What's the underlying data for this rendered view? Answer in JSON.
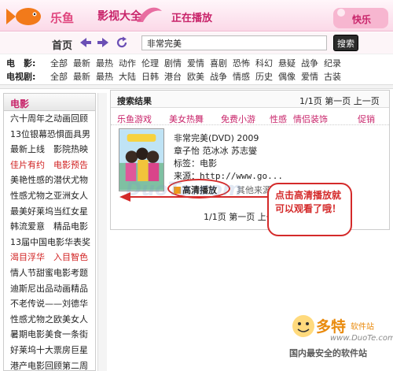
{
  "header": {
    "logo_text": "乐鱼",
    "app_title": "影视大全",
    "now_playing": "正在播放",
    "badge_text": "快乐"
  },
  "nav": {
    "home": "首页",
    "search_value": "非常完美",
    "search_button": "搜索"
  },
  "categories": [
    {
      "label": "电　影:",
      "items": [
        "全部",
        "最新",
        "最热",
        "动作",
        "伦理",
        "剧情",
        "爱情",
        "喜剧",
        "恐怖",
        "科幻",
        "悬疑",
        "战争",
        "纪录"
      ]
    },
    {
      "label": "电视剧:",
      "items": [
        "全部",
        "最新",
        "最热",
        "大陆",
        "日韩",
        "港台",
        "欧美",
        "战争",
        "情感",
        "历史",
        "偶像",
        "爱情",
        "古装"
      ]
    }
  ],
  "sidebar": {
    "title": "电影",
    "items": [
      {
        "text": "六十周年之动画回顾",
        "red": false
      },
      {
        "text": "13位银幕恐惧面具男",
        "red": false
      },
      {
        "text": "最新上线　影院热映",
        "red": false
      },
      {
        "text": "佳片有约　电影预告",
        "red": true
      },
      {
        "text": "美艳性感的潜伏尤物",
        "red": false
      },
      {
        "text": "性感尤物之亚洲女人",
        "red": false
      },
      {
        "text": "最美好莱坞当红女星",
        "red": false
      },
      {
        "text": "韩流爱意　精品电影",
        "red": false
      },
      {
        "text": "13届中国电影华表奖",
        "red": false
      },
      {
        "text": "渴目浮华　入目智色",
        "red": true
      },
      {
        "text": "情人节甜蜜电影考题",
        "red": false
      },
      {
        "text": "迪斯尼出品动画精品",
        "red": false
      },
      {
        "text": "不老传说——刘德华",
        "red": false
      },
      {
        "text": "性感尤物之欧美女人",
        "red": false
      },
      {
        "text": "暑期电影美食一条街",
        "red": false
      },
      {
        "text": "好莱坞十大票房巨星",
        "red": false
      },
      {
        "text": "港产电影回顾第二周",
        "red": false
      }
    ]
  },
  "results": {
    "title": "搜索结果",
    "pager_top": "1/1页  第一页  上一页",
    "filters": [
      "乐鱼游戏",
      "美女热舞",
      "免费小游",
      "性感",
      "情侣装饰",
      "促销"
    ],
    "item": {
      "title": "非常完美(DVD) 2009",
      "cast": "章子怡  范冰冰  苏志燮",
      "tag": "标签：电影",
      "source": "来源：http://www.go...",
      "hd_play": "高清播放",
      "more": "其他来源"
    },
    "pager_bottom": "1/1页  第一页  上一页  下一页  尾页"
  },
  "callout": {
    "text": "点击高清播放就可以观看了哦！"
  },
  "watermark": {
    "center": "DuoTe.com",
    "brand": "多特",
    "brand_small": "软件站",
    "domain": "www.DuoTe.com",
    "tagline": "国内最安全的软件站"
  },
  "colors": {
    "accent": "#c8246a",
    "alert_red": "#d42a2a",
    "header_pink": "#fbd9e8",
    "watermark_orange": "#e98a0c"
  }
}
